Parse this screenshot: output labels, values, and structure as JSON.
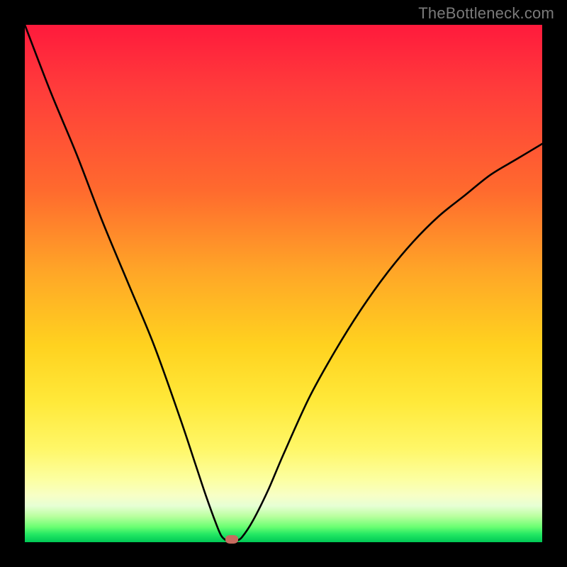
{
  "watermark": "TheBottleneck.com",
  "chart_data": {
    "type": "line",
    "title": "",
    "xlabel": "",
    "ylabel": "",
    "xlim": [
      0,
      100
    ],
    "ylim": [
      0,
      100
    ],
    "grid": false,
    "legend": false,
    "series": [
      {
        "name": "bottleneck-curve",
        "x": [
          0,
          5,
          10,
          15,
          20,
          25,
          30,
          33,
          35,
          37,
          38,
          39,
          40,
          41,
          42,
          44,
          47,
          50,
          55,
          60,
          65,
          70,
          75,
          80,
          85,
          90,
          95,
          100
        ],
        "y": [
          100,
          87,
          75,
          62,
          50,
          38,
          24,
          15,
          9,
          3.5,
          1.2,
          0.3,
          0,
          0.3,
          1,
          4,
          10,
          17,
          28,
          37,
          45,
          52,
          58,
          63,
          67,
          71,
          74,
          77
        ]
      }
    ],
    "annotations": [
      {
        "name": "optimum-marker",
        "x": 40,
        "y": 0.5
      }
    ],
    "colors": {
      "curve": "#000000",
      "marker": "#c76b5f",
      "gradient_top": "#ff1a3c",
      "gradient_mid": "#ffd21f",
      "gradient_bottom": "#00c855",
      "frame": "#000000"
    }
  }
}
